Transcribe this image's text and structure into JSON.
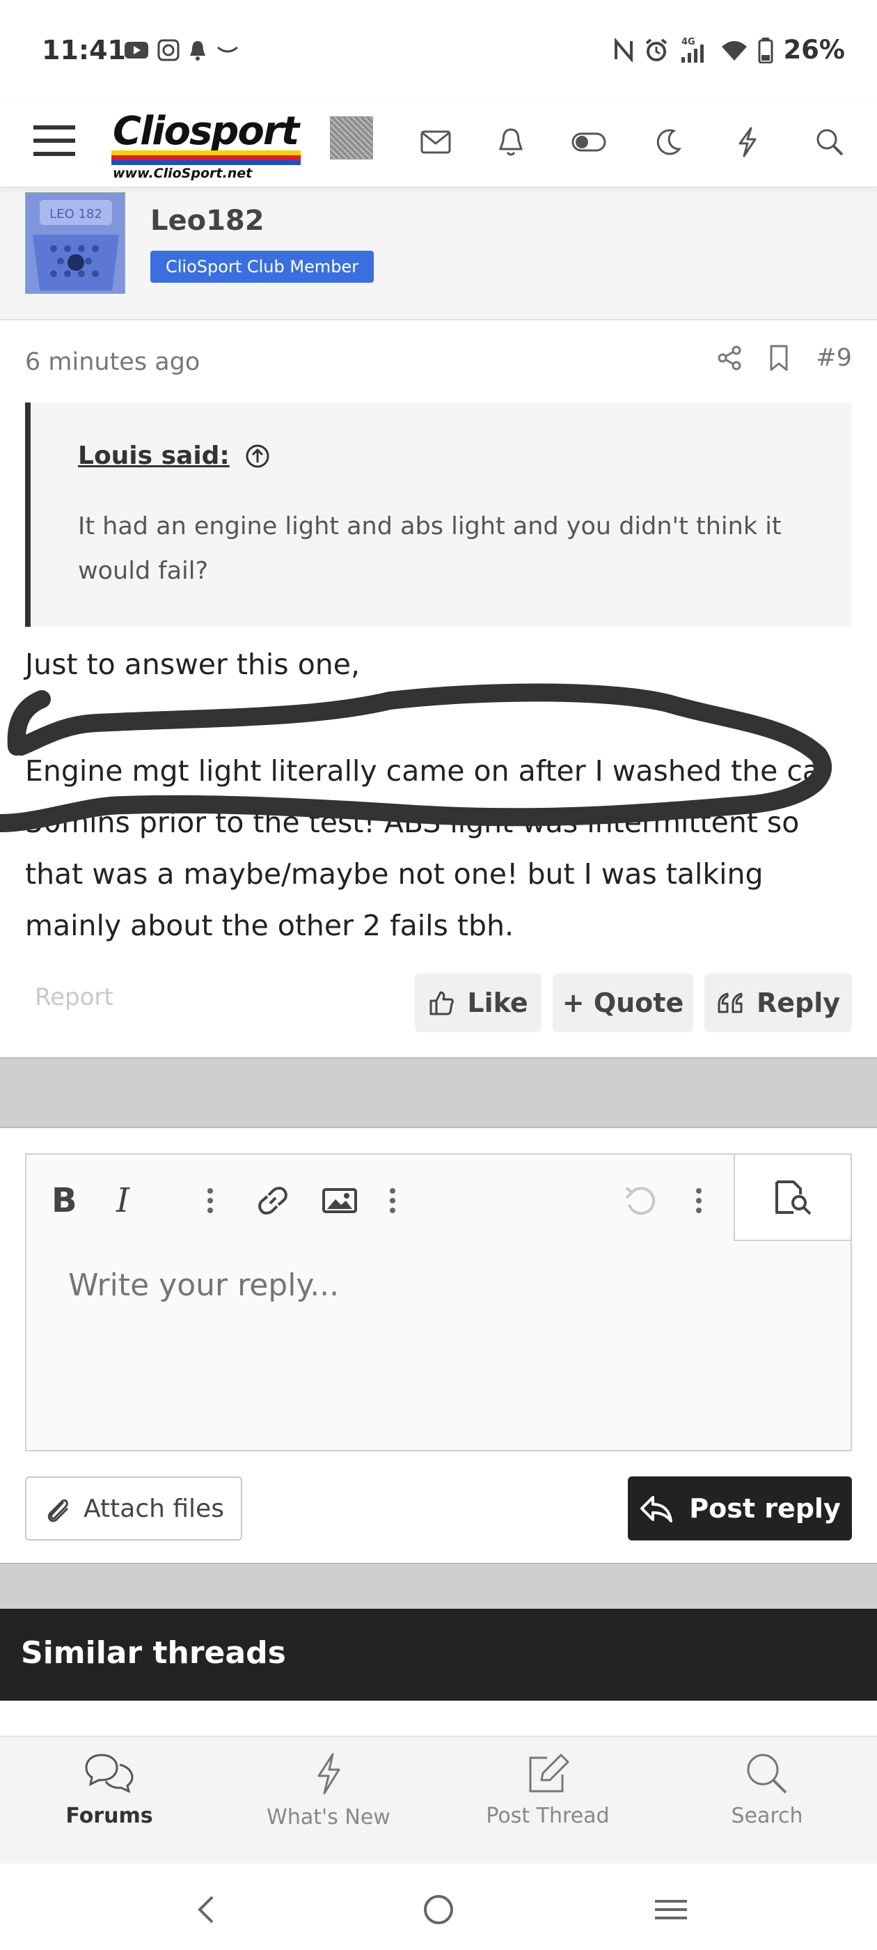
{
  "status_bar": {
    "time": "11:41",
    "network": "4G",
    "battery": "26%"
  },
  "header": {
    "logo_text": "Cliosport",
    "logo_url": "www.ClioSport.net",
    "brand_colors": {
      "black": "#111111",
      "yellow": "#f4d000",
      "red": "#e02020",
      "blue": "#1c4fc4"
    }
  },
  "post": {
    "author": "Leo182",
    "author_avatar_caption": "LEO 182",
    "badge": "ClioSport Club Member",
    "badge_color": "#3b6fe0",
    "time": "6 minutes ago",
    "number": "#9",
    "quote": {
      "author": "Louis said:",
      "text": "It had an engine light and abs light and you didn't think it would fail?"
    },
    "body_line1": "Just to answer this one,",
    "body_para": "Engine mgt light literally came on after I washed the car 30mins prior to the test! ABS light was intermittent so that was a maybe/maybe not one! but I was talking mainly about the other 2 fails tbh.",
    "report_label": "Report",
    "like_label": "Like",
    "quote_label": "+ Quote",
    "reply_label": "Reply"
  },
  "editor": {
    "placeholder": "Write your reply...",
    "attach_label": "Attach files",
    "post_reply_label": "Post reply"
  },
  "similar": {
    "title": "Similar threads"
  },
  "bottom_nav": {
    "items": [
      {
        "label": "Forums",
        "icon": "forums-icon",
        "active": true
      },
      {
        "label": "What's New",
        "icon": "lightning-icon",
        "active": false
      },
      {
        "label": "Post Thread",
        "icon": "edit-icon",
        "active": false
      },
      {
        "label": "Search",
        "icon": "search-icon",
        "active": false
      }
    ]
  }
}
